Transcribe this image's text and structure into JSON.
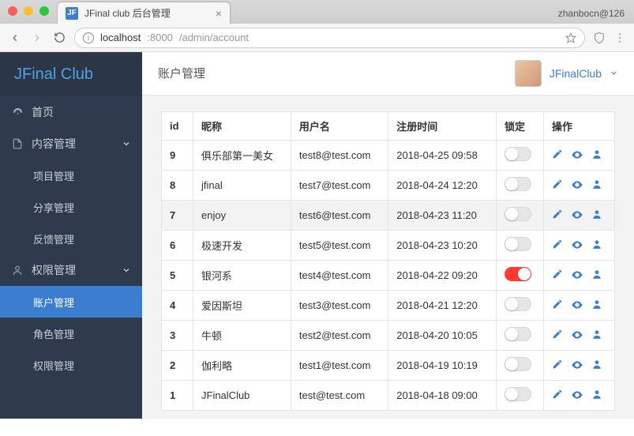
{
  "browser": {
    "tab_title": "JFinal club 后台管理",
    "favicon_text": "JF",
    "profile": "zhanbocn@126",
    "url_host": "localhost",
    "url_port": ":8000",
    "url_path": "/admin/account"
  },
  "brand": "JFinal Club",
  "sidebar": {
    "home": "首页",
    "content": "内容管理",
    "content_children": {
      "project": "项目管理",
      "share": "分享管理",
      "feedback": "反馈管理"
    },
    "perm": "权限管理",
    "perm_children": {
      "account": "账户管理",
      "role": "角色管理",
      "permission": "权限管理"
    }
  },
  "page": {
    "title": "账户管理",
    "user_name": "JFinalClub"
  },
  "table": {
    "headers": {
      "id": "id",
      "nick": "昵称",
      "user": "用户名",
      "reg": "注册时间",
      "lock": "锁定",
      "act": "操作"
    },
    "rows": [
      {
        "id": "9",
        "nick": "俱乐部第一美女",
        "user": "test8@test.com",
        "reg": "2018-04-25 09:58",
        "locked": false
      },
      {
        "id": "8",
        "nick": "jfinal",
        "user": "test7@test.com",
        "reg": "2018-04-24 12:20",
        "locked": false
      },
      {
        "id": "7",
        "nick": "enjoy",
        "user": "test6@test.com",
        "reg": "2018-04-23 11:20",
        "locked": false
      },
      {
        "id": "6",
        "nick": "极速开发",
        "user": "test5@test.com",
        "reg": "2018-04-23 10:20",
        "locked": false
      },
      {
        "id": "5",
        "nick": "银河系",
        "user": "test4@test.com",
        "reg": "2018-04-22 09:20",
        "locked": true
      },
      {
        "id": "4",
        "nick": "爱因斯坦",
        "user": "test3@test.com",
        "reg": "2018-04-21 12:20",
        "locked": false
      },
      {
        "id": "3",
        "nick": "牛顿",
        "user": "test2@test.com",
        "reg": "2018-04-20 10:05",
        "locked": false
      },
      {
        "id": "2",
        "nick": "伽利略",
        "user": "test1@test.com",
        "reg": "2018-04-19 10:19",
        "locked": false
      },
      {
        "id": "1",
        "nick": "JFinalClub",
        "user": "test@test.com",
        "reg": "2018-04-18 09:00",
        "locked": false
      }
    ]
  }
}
